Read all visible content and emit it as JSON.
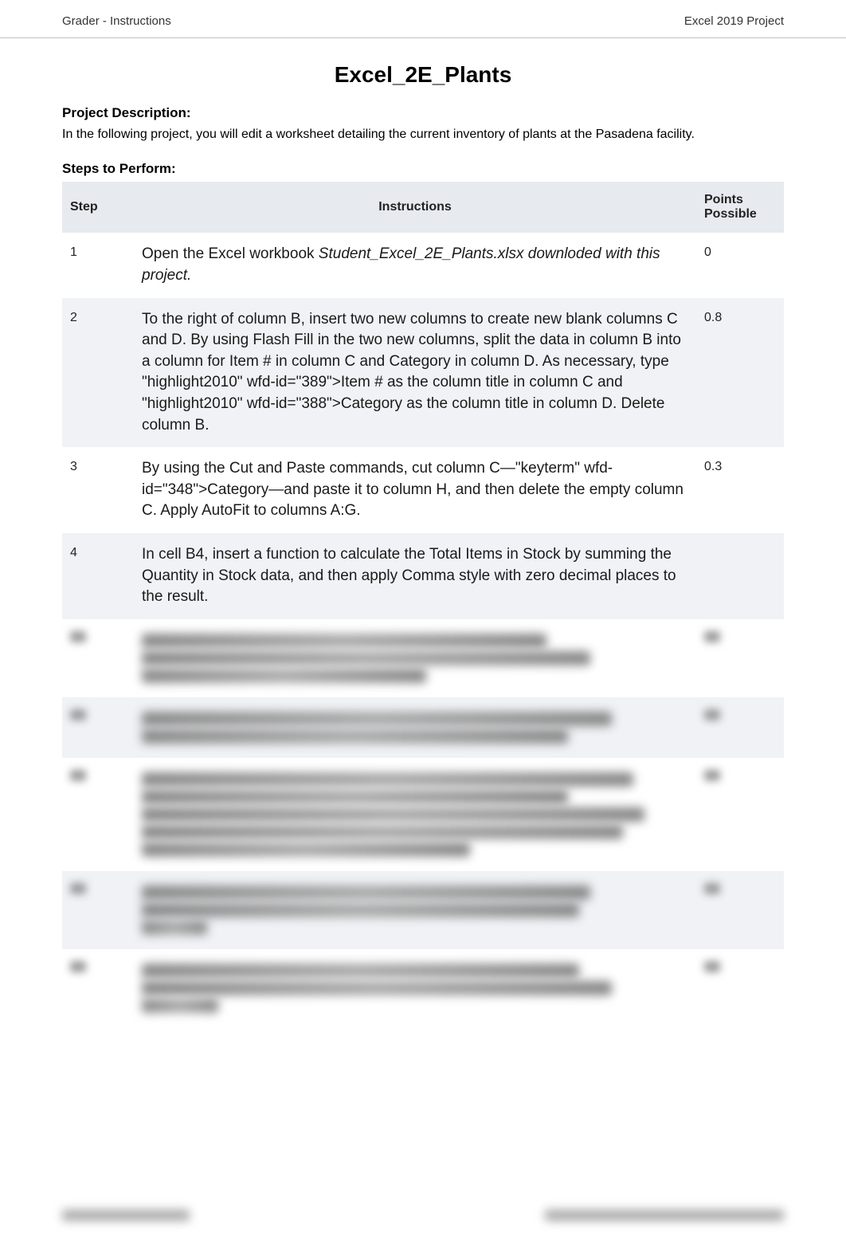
{
  "header": {
    "left": "Grader - Instructions",
    "right": "Excel 2019 Project"
  },
  "title": "Excel_2E_Plants",
  "project_description": {
    "heading": "Project Description:",
    "text": "In the following project, you will edit a worksheet detailing the current inventory of plants at the Pasadena facility."
  },
  "steps_heading": "Steps to Perform:",
  "table": {
    "headers": {
      "step": "Step",
      "instructions": "Instructions",
      "points": "Points Possible"
    },
    "rows": [
      {
        "step": "1",
        "instructions_plain": "Open the Excel workbook ",
        "instructions_italic": "Student_Excel_2E_Plants.xlsx downloded with this project.",
        "points": "0"
      },
      {
        "step": "2",
        "instructions_plain": "To the right of column B, insert two new columns to create new blank columns C and D. By using Flash Fill in the two new columns, split the data in column B into a column for Item # in column C and Category in column D. As necessary, type \"highlight2010\" wfd-id=\"389\">Item # as the column title in column C and \"highlight2010\" wfd-id=\"388\">Category as the column title in column D. Delete column B.",
        "instructions_italic": "",
        "points": "0.8"
      },
      {
        "step": "3",
        "instructions_plain": "By using the Cut and Paste commands, cut column C—\"keyterm\" wfd-id=\"348\">Category—and paste it to column H, and then delete the empty column C. Apply AutoFit to columns A:G.",
        "instructions_italic": "",
        "points": "0.3"
      },
      {
        "step": "4",
        "instructions_plain": "In cell B4, insert a function to calculate the Total Items in Stock by summing the Quantity in Stock data, and then apply Comma style with zero decimal places to the result.",
        "instructions_italic": "",
        "points": ""
      }
    ]
  }
}
